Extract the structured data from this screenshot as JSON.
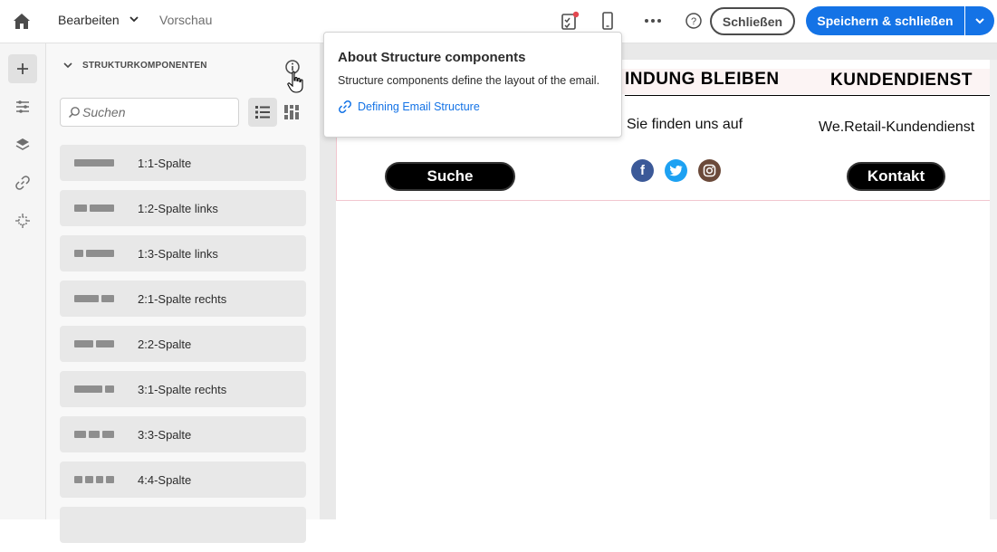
{
  "header": {
    "tab_edit": "Bearbeiten",
    "tab_preview": "Vorschau",
    "close_label": "Schließen",
    "save_label": "Speichern & schließen"
  },
  "panel": {
    "title": "STRUKTURKOMPONENTEN",
    "search_placeholder": "Suchen",
    "components": [
      {
        "label": "1:1-Spalte",
        "blocks": [
          1
        ]
      },
      {
        "label": "1:2-Spalte links",
        "blocks": [
          1,
          2
        ]
      },
      {
        "label": "1:3-Spalte links",
        "blocks": [
          1,
          3
        ]
      },
      {
        "label": "2:1-Spalte rechts",
        "blocks": [
          2,
          1
        ]
      },
      {
        "label": "2:2-Spalte",
        "blocks": [
          1,
          1
        ]
      },
      {
        "label": "3:1-Spalte rechts",
        "blocks": [
          3,
          1
        ]
      },
      {
        "label": "3:3-Spalte",
        "blocks": [
          1,
          1,
          1
        ]
      },
      {
        "label": "4:4-Spalte",
        "blocks": [
          1,
          1,
          1,
          1
        ]
      }
    ]
  },
  "email": {
    "heading_middle": "INDUNG BLEIBEN",
    "heading_right": "KUNDENDIENST",
    "text_middle": "Sie finden uns auf",
    "text_right": "We.Retail-Kundendienst",
    "button_left": "Suche",
    "button_right": "Kontakt",
    "social": [
      {
        "name": "facebook-icon",
        "glyph": "f",
        "color": "#3b5998"
      },
      {
        "name": "twitter-icon",
        "glyph": "t",
        "color": "#1da1f2"
      },
      {
        "name": "instagram-icon",
        "glyph": "◎",
        "color": "#6b4a3a"
      }
    ]
  },
  "popover": {
    "title": "About Structure components",
    "text": "Structure components define the layout of the email.",
    "link": "Defining Email Structure"
  },
  "colors": {
    "accent": "#1473e6",
    "notification_dot": "#e34850"
  }
}
